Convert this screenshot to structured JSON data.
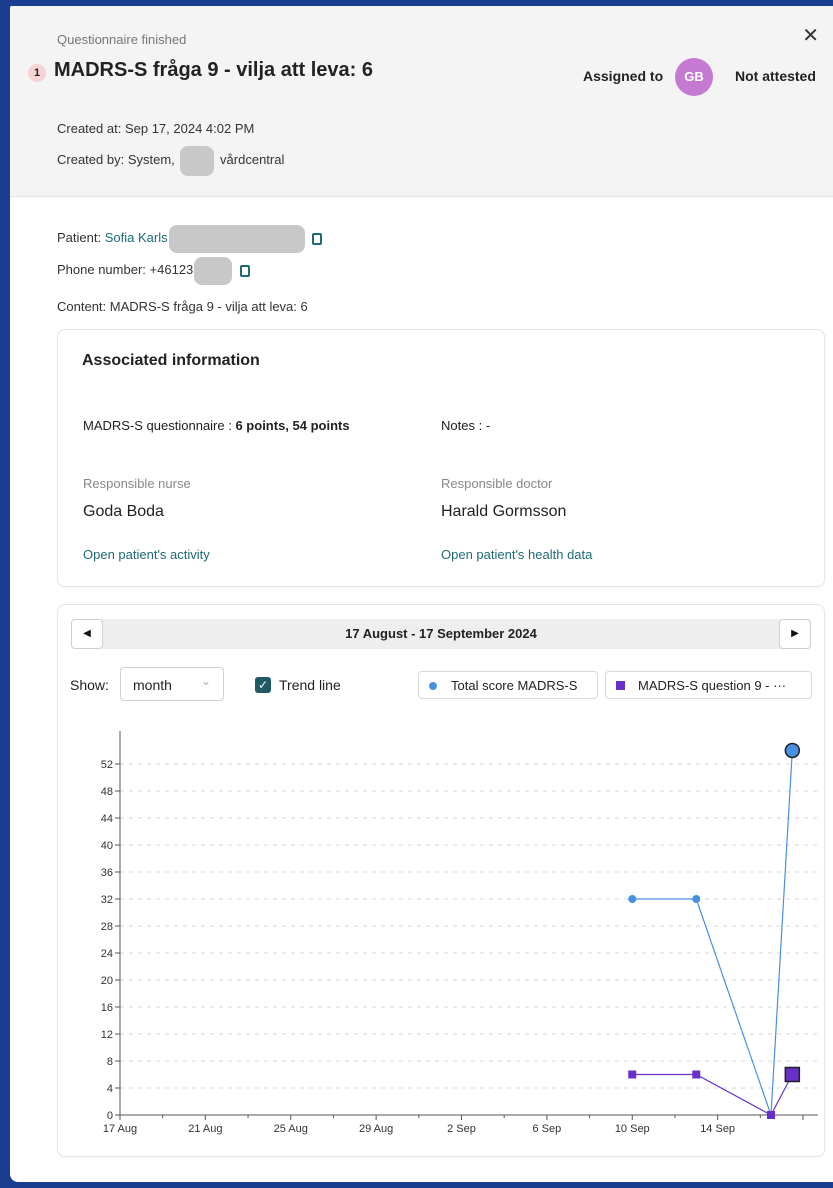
{
  "header": {
    "status": "Questionnaire finished",
    "priority": "1",
    "title": "MADRS-S fråga 9 - vilja att leva: 6",
    "assigned_label": "Assigned to",
    "assignee_initials": "GB",
    "attest_status": "Not attested",
    "created_at_label": "Created at:",
    "created_at": "Sep 17, 2024 4:02 PM",
    "created_by_label": "Created by:",
    "created_by_prefix": "System,",
    "created_by_suffix": "vårdcentral"
  },
  "details": {
    "patient_label": "Patient:",
    "patient_name": "Sofia Karls",
    "phone_label": "Phone number:",
    "phone": "+46123",
    "content_label": "Content:",
    "content": "MADRS-S fråga 9 - vilja att leva: 6"
  },
  "associated": {
    "title": "Associated information",
    "questionnaire_label": "MADRS-S questionnaire :",
    "questionnaire_value": "6 points, 54 points",
    "notes_label": "Notes :",
    "notes_value": "-",
    "nurse_label": "Responsible nurse",
    "nurse_name": "Goda Boda",
    "doctor_label": "Responsible doctor",
    "doctor_name": "Harald Gormsson",
    "activity_link": "Open patient's activity",
    "health_link": "Open patient's health data"
  },
  "chart_controls": {
    "date_range": "17 August - 17 September 2024",
    "prev_icon": "caret-left-icon",
    "next_icon": "caret-right-icon",
    "show_label": "Show:",
    "period": "month",
    "trend_label": "Trend line",
    "trend_checked": true,
    "legend_total": "Total score MADRS-S",
    "legend_q9": "MADRS-S question 9 - ···"
  },
  "colors": {
    "accent_teal": "#1f6b75",
    "total_series": "#4a90e2",
    "q9_series": "#6a2fc8",
    "avatar": "#c47ad1"
  },
  "chart_data": {
    "type": "line",
    "x_ticks": [
      "17 Aug",
      "21 Aug",
      "25 Aug",
      "29 Aug",
      "2 Sep",
      "6 Sep",
      "10 Sep",
      "14 Sep"
    ],
    "y_ticks": [
      0,
      4,
      8,
      12,
      16,
      20,
      24,
      28,
      32,
      36,
      40,
      44,
      48,
      52
    ],
    "ylim": [
      0,
      56
    ],
    "xlim_days": [
      0,
      32
    ],
    "grid": true,
    "series": [
      {
        "name": "Total score MADRS-S",
        "color": "#4a90e2",
        "marker": "circle",
        "points": [
          {
            "day": 24,
            "y": 32
          },
          {
            "day": 27,
            "y": 32
          },
          {
            "day": 30.5,
            "y": 0
          },
          {
            "day": 31.5,
            "y": 54
          }
        ]
      },
      {
        "name": "MADRS-S question 9 - ···",
        "color": "#6a2fc8",
        "marker": "square",
        "points": [
          {
            "day": 24,
            "y": 6
          },
          {
            "day": 27,
            "y": 6
          },
          {
            "day": 30.5,
            "y": 0
          },
          {
            "day": 31.5,
            "y": 6
          }
        ]
      }
    ]
  }
}
